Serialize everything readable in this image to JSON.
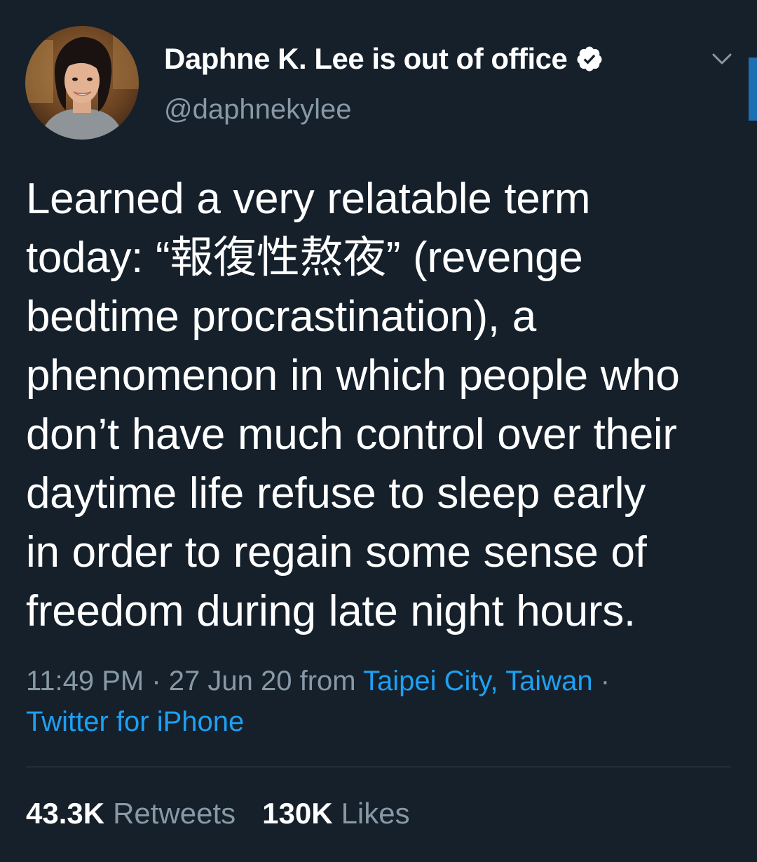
{
  "author": {
    "display_name": "Daphne K. Lee is out of office",
    "handle": "@daphnekylee",
    "verified_icon": "verified-badge-icon"
  },
  "tweet": {
    "lines": [
      "Learned a very relatable term",
      "today: “報復性熬夜” (revenge",
      "bedtime procrastination), a",
      "phenomenon in which people who",
      "don’t have much control over their",
      "daytime life refuse to sleep early",
      "in order to regain some sense of",
      "freedom during late night hours."
    ]
  },
  "meta": {
    "time": "11:49 PM",
    "separator": " · ",
    "date": "27 Jun 20",
    "from_label": " from ",
    "location": "Taipei City, Taiwan",
    "separator2": " ·",
    "source": "Twitter for iPhone"
  },
  "stats": {
    "retweets_count": "43.3K",
    "retweets_label": "Retweets",
    "likes_count": "130K",
    "likes_label": "Likes"
  },
  "colors": {
    "background": "#15202b",
    "secondary_text": "#8899a6",
    "link": "#1da1f2",
    "divider": "#38444d"
  }
}
